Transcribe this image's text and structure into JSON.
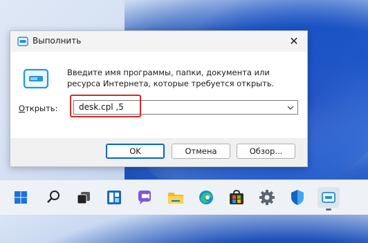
{
  "dialog": {
    "title": "Выполнить",
    "description": "Введите имя программы, папки, документа или ресурса Интернета, которые требуется открыть.",
    "open_label_accel": "О",
    "open_label_rest": "ткрыть:",
    "combo_value": "desk.cpl ,5",
    "buttons": {
      "ok": "OK",
      "cancel": "Отмена",
      "browse": "Обзор..."
    },
    "close_glyph": "✕"
  },
  "taskbar": {
    "items": [
      {
        "icon": "windows-start-icon"
      },
      {
        "icon": "search-icon"
      },
      {
        "icon": "task-view-icon"
      },
      {
        "icon": "widgets-icon"
      },
      {
        "icon": "teams-chat-icon"
      },
      {
        "icon": "file-explorer-icon"
      },
      {
        "icon": "edge-icon"
      },
      {
        "icon": "store-icon"
      },
      {
        "icon": "settings-icon"
      },
      {
        "icon": "security-icon"
      },
      {
        "icon": "run-app-icon",
        "active": true
      }
    ]
  },
  "colors": {
    "accent": "#0067c0",
    "highlight": "#d62828"
  }
}
